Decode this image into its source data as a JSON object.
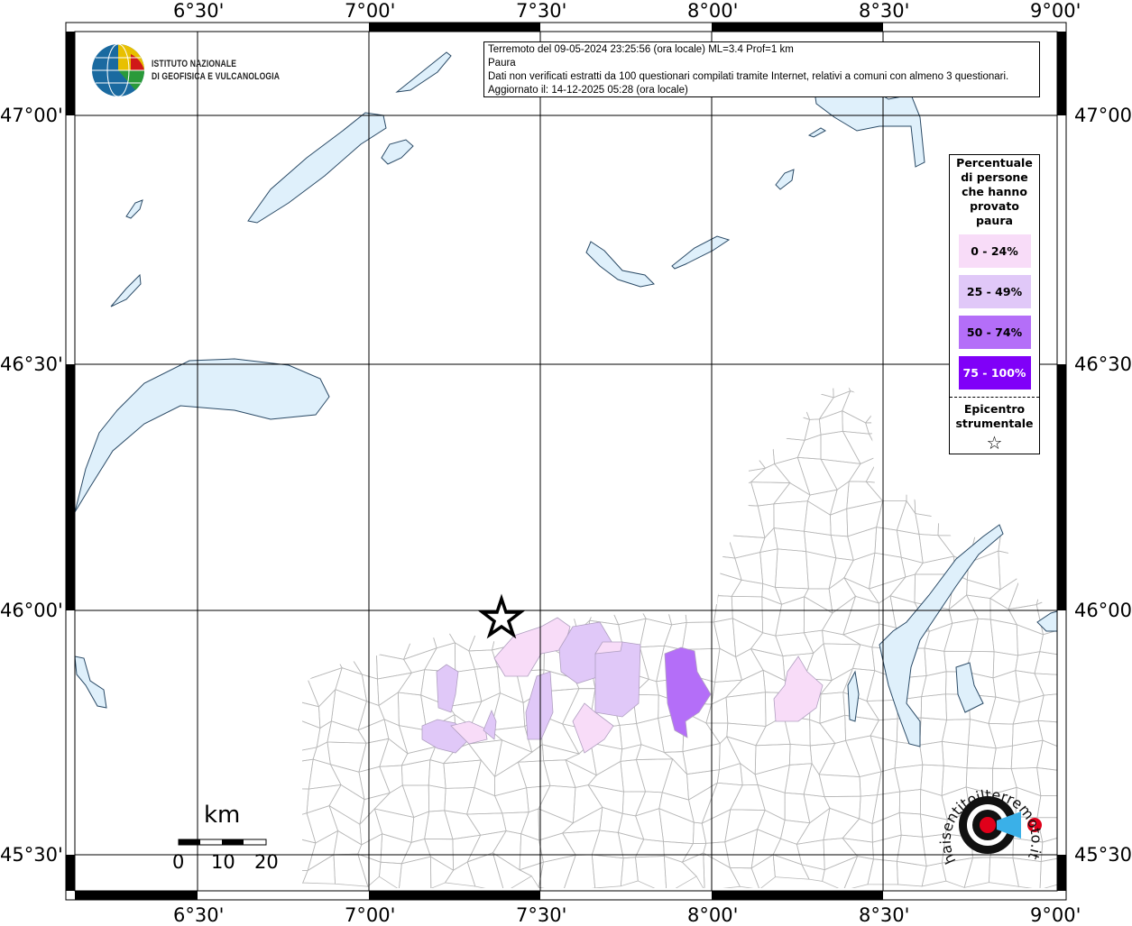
{
  "info_box": {
    "line1": "Terremoto del 09-05-2024 23:25:56 (ora locale) ML=3.4 Prof=1 km",
    "line2": "Paura",
    "line3": "Dati non verificati estratti da 100 questionari compilati tramite Internet, relativi a comuni con almeno 3 questionari.",
    "line4": "Aggiornato il: 14-12-2025 05:28 (ora locale)"
  },
  "logo_ingv": {
    "line1": "ISTITUTO NAZIONALE",
    "line2": "DI GEOFISICA E VULCANOLOGIA"
  },
  "logo_hsit": "www.haisentitoilterremoto.it",
  "axes": {
    "lon_labels": [
      "6°30'",
      "7°00'",
      "7°30'",
      "8°00'",
      "8°30'",
      "9°00'"
    ],
    "lat_labels": [
      "47°00'",
      "46°30'",
      "46°00'",
      "45°30'"
    ]
  },
  "legend": {
    "title": [
      "Percentuale",
      "di persone",
      "che hanno",
      "provato",
      "paura"
    ],
    "classes": [
      {
        "label": "0 - 24%",
        "color": "#f8dcf8",
        "text_color": "#000000"
      },
      {
        "label": "25 - 49%",
        "color": "#e0c8f8",
        "text_color": "#000000"
      },
      {
        "label": "50 - 74%",
        "color": "#b46ef8",
        "text_color": "#000000"
      },
      {
        "label": "75 - 100%",
        "color": "#8000f8",
        "text_color": "#ffffff"
      }
    ],
    "epicenter_label": [
      "Epicentro",
      "strumentale"
    ],
    "epicenter_symbol": "☆"
  },
  "scale_bar": {
    "unit": "km",
    "ticks": [
      "0",
      "10",
      "20"
    ]
  },
  "colors": {
    "lake": "#dff0fb",
    "lake_edge": "#2a4a66",
    "boundary": "#b8b8b8"
  }
}
